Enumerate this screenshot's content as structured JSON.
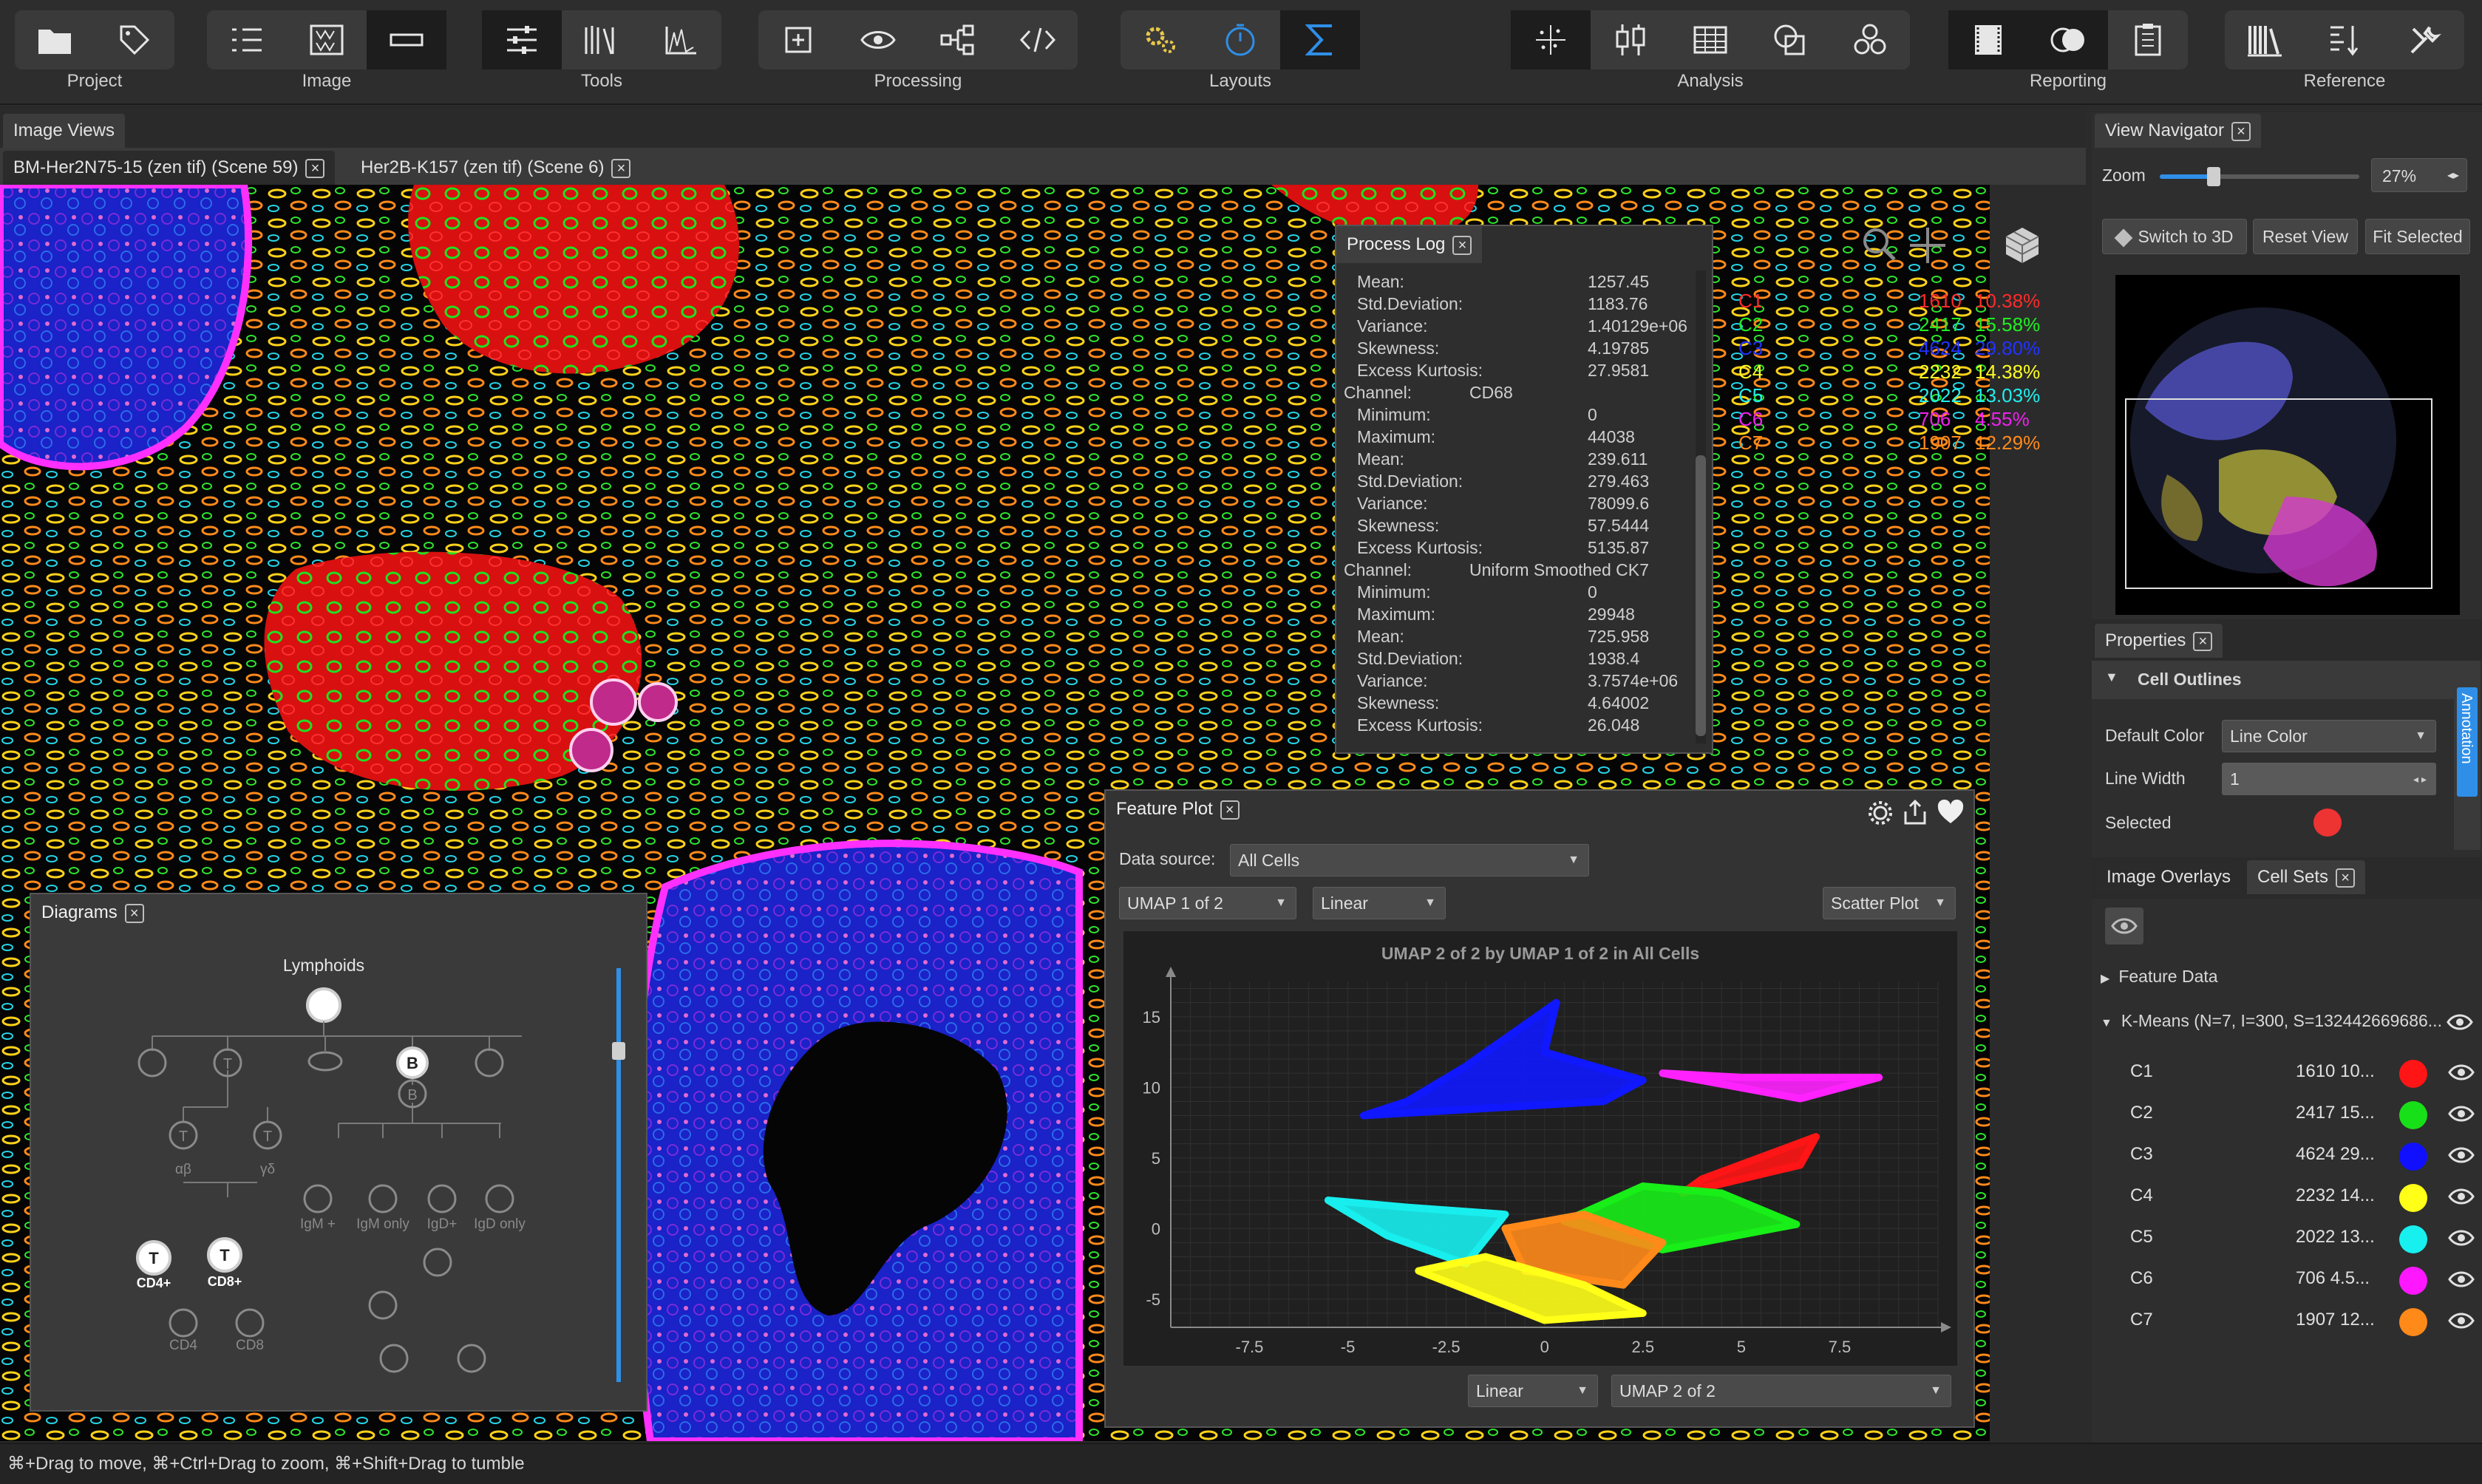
{
  "toolbar": {
    "groups": [
      {
        "label": "Project",
        "icons": [
          "folder-icon",
          "tag-icon"
        ]
      },
      {
        "label": "Image",
        "icons": [
          "list-icon",
          "channels-icon",
          "region-icon"
        ]
      },
      {
        "label": "Tools",
        "icons": [
          "sliders-icon",
          "book-icon",
          "histogram-icon"
        ]
      },
      {
        "label": "Processing",
        "icons": [
          "crop-icon",
          "eye-icon",
          "workflow-icon",
          "code-icon"
        ]
      },
      {
        "label": "Layouts",
        "icons": [
          "gears-icon",
          "timer-icon",
          "sigma-icon"
        ]
      },
      {
        "label": "Analysis",
        "icons": [
          "scatter-icon",
          "boxplot-icon",
          "table-icon",
          "shapes-icon",
          "cluster-icon"
        ]
      },
      {
        "label": "Reporting",
        "icons": [
          "film-icon",
          "overlap-icon",
          "clipboard-icon"
        ]
      },
      {
        "label": "Reference",
        "icons": [
          "library-icon",
          "sort-icon",
          "tools-icon"
        ]
      }
    ]
  },
  "image_views_tab": "Image Views",
  "doc_tabs": [
    "BM-Her2N75-15 (zen tif) (Scene 59)",
    "Her2B-K157 (zen tif) (Scene 6)"
  ],
  "process_log": {
    "title": "Process Log",
    "rows": [
      {
        "k": "Mean:",
        "v": "1257.45"
      },
      {
        "k": "Std.Deviation:",
        "v": "1183.76"
      },
      {
        "k": "Variance:",
        "v": "1.40129e+06"
      },
      {
        "k": "Skewness:",
        "v": "4.19785"
      },
      {
        "k": "Excess Kurtosis:",
        "v": "27.9581"
      },
      {
        "k": "Channel:",
        "v": "CD68",
        "channel": true
      },
      {
        "k": "Minimum:",
        "v": "0"
      },
      {
        "k": "Maximum:",
        "v": "44038"
      },
      {
        "k": "Mean:",
        "v": "239.611"
      },
      {
        "k": "Std.Deviation:",
        "v": "279.463"
      },
      {
        "k": "Variance:",
        "v": "78099.6"
      },
      {
        "k": "Skewness:",
        "v": "57.5444"
      },
      {
        "k": "Excess Kurtosis:",
        "v": "5135.87"
      },
      {
        "k": "Channel:",
        "v": "Uniform Smoothed CK7",
        "channel": true
      },
      {
        "k": "Minimum:",
        "v": "0"
      },
      {
        "k": "Maximum:",
        "v": "29948"
      },
      {
        "k": "Mean:",
        "v": "725.958"
      },
      {
        "k": "Std.Deviation:",
        "v": "1938.4"
      },
      {
        "k": "Variance:",
        "v": "3.7574e+06"
      },
      {
        "k": "Skewness:",
        "v": "4.64002"
      },
      {
        "k": "Excess Kurtosis:",
        "v": "26.048"
      }
    ]
  },
  "cluster_legend": [
    {
      "name": "C1",
      "count": "1610",
      "pct": "10.38%",
      "color": "#ff2a2a"
    },
    {
      "name": "C2",
      "count": "2417",
      "pct": "15.58%",
      "color": "#22ee22"
    },
    {
      "name": "C3",
      "count": "4624",
      "pct": "29.80%",
      "color": "#2233ff"
    },
    {
      "name": "C4",
      "count": "2232",
      "pct": "14.38%",
      "color": "#ffff22"
    },
    {
      "name": "C5",
      "count": "2022",
      "pct": "13.03%",
      "color": "#22eeee"
    },
    {
      "name": "C6",
      "count": "706",
      "pct": "4.55%",
      "color": "#ee22ee"
    },
    {
      "name": "C7",
      "count": "1907",
      "pct": "12.29%",
      "color": "#ff8a1a"
    }
  ],
  "diagrams": {
    "title": "Diagrams",
    "root_label": "Lymphoids",
    "labels": [
      "αβ",
      "γδ",
      "CD4+",
      "CD8+",
      "IgM +",
      "IgM only",
      "IgD+",
      "IgD only",
      "CD4",
      "CD8"
    ]
  },
  "feature_plot": {
    "title": "Feature Plot",
    "data_source_label": "Data source:",
    "data_source_value": "All Cells",
    "x_feature": "UMAP 1 of 2",
    "x_scale": "Linear",
    "plot_type": "Scatter Plot",
    "y_scale": "Linear",
    "y_feature": "UMAP 2 of 2"
  },
  "chart_data": {
    "type": "scatter",
    "title": "UMAP 2 of 2 by UMAP 1 of 2 in All Cells",
    "xlabel": "",
    "ylabel": "",
    "xlim": [
      -9.5,
      10
    ],
    "ylim": [
      -7,
      17.5
    ],
    "xticks": [
      "-7.5",
      "-5",
      "-2.5",
      "0",
      "2.5",
      "5",
      "7.5"
    ],
    "yticks": [
      "15",
      "10",
      "5",
      "0",
      "-5"
    ],
    "grid": true,
    "series": [
      {
        "name": "C3",
        "color": "#1018ff",
        "x": [
          -4.6,
          -2.0,
          0.3,
          2.5,
          -3.5,
          1.5,
          0.0
        ],
        "y": [
          8.0,
          11.5,
          16.0,
          10.5,
          9.0,
          9.0,
          12.5
        ]
      },
      {
        "name": "C6",
        "color": "#ff22ff",
        "x": [
          3.0,
          5.0,
          6.5,
          8.5
        ],
        "y": [
          11.0,
          10.7,
          9.2,
          10.7
        ]
      },
      {
        "name": "C1",
        "color": "#ff1515",
        "x": [
          3.5,
          6.5,
          6.9,
          4.0
        ],
        "y": [
          2.5,
          4.5,
          6.5,
          3.5
        ]
      },
      {
        "name": "C2",
        "color": "#18ee18",
        "x": [
          0.5,
          2.5,
          4.5,
          6.4,
          3.0
        ],
        "y": [
          0.5,
          3.0,
          2.5,
          0.3,
          -1.5
        ]
      },
      {
        "name": "C5",
        "color": "#18eeee",
        "x": [
          -5.5,
          -3.5,
          -1.0,
          -2.0,
          -4.0
        ],
        "y": [
          2.0,
          1.5,
          1.0,
          -2.5,
          -0.5
        ]
      },
      {
        "name": "C7",
        "color": "#ff8a1a",
        "x": [
          -1.0,
          1.0,
          3.0,
          2.0,
          -0.5
        ],
        "y": [
          0.0,
          1.0,
          -1.0,
          -4.0,
          -3.0
        ]
      },
      {
        "name": "C4",
        "color": "#ffff18",
        "x": [
          -3.2,
          -1.5,
          1.0,
          2.5,
          0.0
        ],
        "y": [
          -3.0,
          -2.0,
          -4.0,
          -6.0,
          -6.5
        ]
      }
    ]
  },
  "view_navigator": {
    "title": "View Navigator",
    "zoom_label": "Zoom",
    "zoom_value": "27%",
    "zoom_fraction": 0.27,
    "buttons": [
      "Switch to 3D",
      "Reset View",
      "Fit Selected"
    ]
  },
  "properties": {
    "title": "Properties",
    "section": "Cell Outlines",
    "default_color_label": "Default Color",
    "default_color_value": "Line Color",
    "line_width_label": "Line Width",
    "line_width_value": "1",
    "selected_label": "Selected",
    "selected_color": "#ee3333",
    "side_tab": "Annotation"
  },
  "lower_tabs": [
    "Image Overlays",
    "Cell Sets"
  ],
  "cell_sets": {
    "feature_data": "Feature Data",
    "kmeans": "K-Means (N=7, I=300, S=132442669686...",
    "rows": [
      {
        "name": "C1",
        "value": "1610 10...",
        "color": "#ff1515"
      },
      {
        "name": "C2",
        "value": "2417 15...",
        "color": "#18e018"
      },
      {
        "name": "C3",
        "value": "4624 29...",
        "color": "#1010ff"
      },
      {
        "name": "C4",
        "value": "2232 14...",
        "color": "#ffff18"
      },
      {
        "name": "C5",
        "value": "2022 13...",
        "color": "#18f0f0"
      },
      {
        "name": "C6",
        "value": "706 4.5...",
        "color": "#ff18ff"
      },
      {
        "name": "C7",
        "value": "1907 12...",
        "color": "#ff8a1a"
      }
    ]
  },
  "status_bar": "⌘+Drag to move, ⌘+Ctrl+Drag to zoom, ⌘+Shift+Drag to tumble"
}
